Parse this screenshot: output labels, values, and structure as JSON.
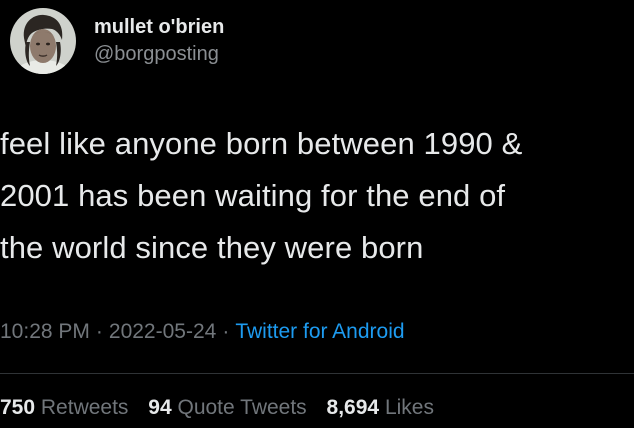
{
  "user": {
    "display_name": "mullet o'brien",
    "handle": "@borgposting",
    "avatar_icon": "profile-photo"
  },
  "tweet": {
    "text": "feel like anyone born between 1990 &\n2001 has been waiting for the end of\nthe world since they were born",
    "time": "10:28 PM",
    "date": "2022-05-24",
    "separator": "·",
    "source": "Twitter for Android"
  },
  "stats": {
    "retweets_count": "750",
    "retweets_label": "Retweets",
    "quotes_count": "94",
    "quotes_label": "Quote Tweets",
    "likes_count": "8,694",
    "likes_label": "Likes"
  },
  "colors": {
    "background": "#000000",
    "text": "#e7e9ea",
    "secondary": "#71767b",
    "link": "#1d9bf0"
  }
}
